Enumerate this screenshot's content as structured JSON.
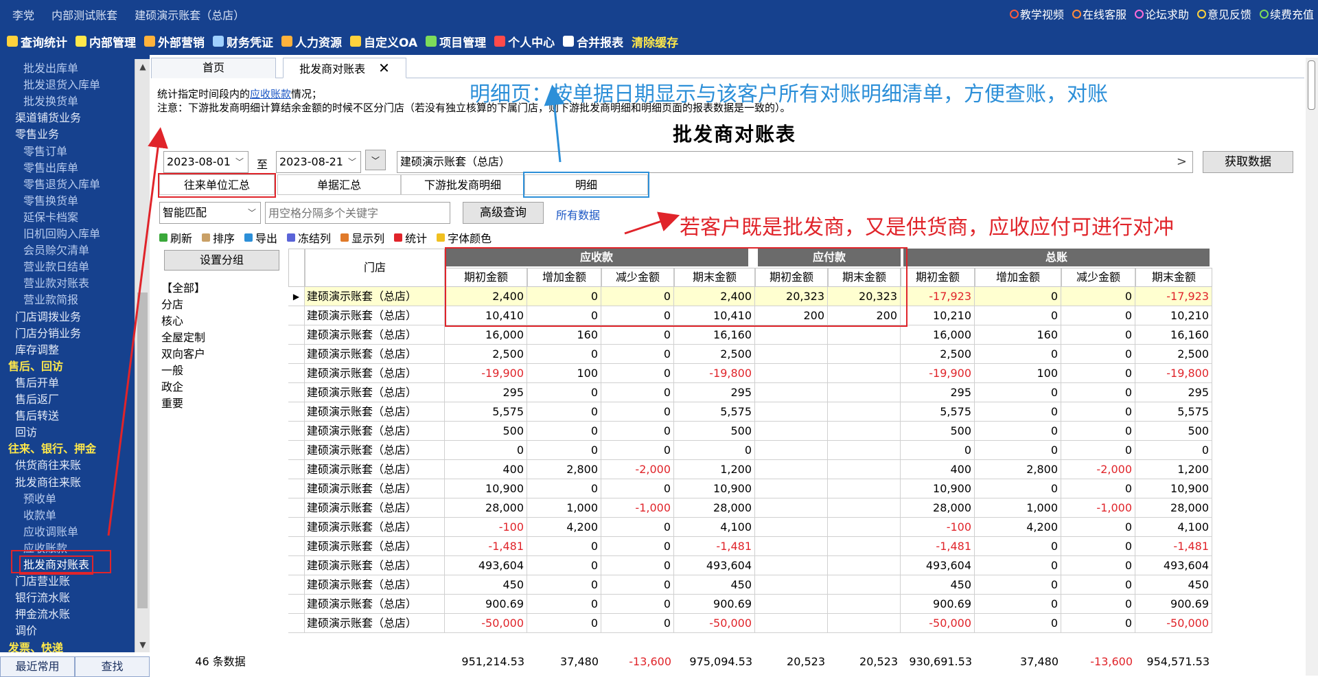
{
  "header": {
    "user": "李党",
    "account": "内部测试账套",
    "company": "建硕演示账套（总店）",
    "links": [
      {
        "label": "教学视频",
        "icon": "play-icon",
        "color": "#ff5a3c"
      },
      {
        "label": "在线客服",
        "icon": "service-icon",
        "color": "#ff8c3c"
      },
      {
        "label": "论坛求助",
        "icon": "forum-icon",
        "color": "#ff6cd8"
      },
      {
        "label": "意见反馈",
        "icon": "pen-icon",
        "color": "#ffd23c"
      },
      {
        "label": "续费充值",
        "icon": "coin-icon",
        "color": "#7ddc5a"
      }
    ]
  },
  "menu": [
    {
      "label": "查询统计",
      "icon": "chart-icon",
      "color": "#ffd23c"
    },
    {
      "label": "内部管理",
      "icon": "diamond-icon",
      "color": "#ffe84a"
    },
    {
      "label": "外部营销",
      "icon": "bag-icon",
      "color": "#ffb23c"
    },
    {
      "label": "财务凭证",
      "icon": "document-icon",
      "color": "#9fd0ff"
    },
    {
      "label": "人力资源",
      "icon": "person-icon",
      "color": "#ffb23c"
    },
    {
      "label": "自定义OA",
      "icon": "tools-icon",
      "color": "#ffd23c"
    },
    {
      "label": "项目管理",
      "icon": "gear-icon",
      "color": "#7ddc5a"
    },
    {
      "label": "个人中心",
      "icon": "heart-icon",
      "color": "#ff4a4a"
    },
    {
      "label": "合并报表",
      "icon": "file-icon",
      "color": "#ffffff"
    },
    {
      "label": "清除缓存",
      "icon": "",
      "color": "",
      "yellow": true
    }
  ],
  "sidebar": {
    "items": [
      {
        "label": "批发出库单",
        "level": 3
      },
      {
        "label": "批发退货入库单",
        "level": 3
      },
      {
        "label": "批发换货单",
        "level": 3
      },
      {
        "label": "渠道铺货业务",
        "level": 2
      },
      {
        "label": "零售业务",
        "level": 2
      },
      {
        "label": "零售订单",
        "level": 3
      },
      {
        "label": "零售出库单",
        "level": 3
      },
      {
        "label": "零售退货入库单",
        "level": 3
      },
      {
        "label": "零售换货单",
        "level": 3
      },
      {
        "label": "延保卡档案",
        "level": 3
      },
      {
        "label": "旧机回购入库单",
        "level": 3
      },
      {
        "label": "会员赊欠清单",
        "level": 3
      },
      {
        "label": "营业款日结单",
        "level": 3
      },
      {
        "label": "营业款对账表",
        "level": 3
      },
      {
        "label": "营业款简报",
        "level": 3
      },
      {
        "label": "门店调拨业务",
        "level": 2
      },
      {
        "label": "门店分销业务",
        "level": 2
      },
      {
        "label": "库存调整",
        "level": 2
      },
      {
        "label": "售后、回访",
        "level": 1
      },
      {
        "label": "售后开单",
        "level": 2
      },
      {
        "label": "售后返厂",
        "level": 2
      },
      {
        "label": "售后转送",
        "level": 2
      },
      {
        "label": "回访",
        "level": 2
      },
      {
        "label": "往来、银行、押金",
        "level": 1
      },
      {
        "label": "供货商往来账",
        "level": 2
      },
      {
        "label": "批发商往来账",
        "level": 2
      },
      {
        "label": "预收单",
        "level": 3
      },
      {
        "label": "收款单",
        "level": 3
      },
      {
        "label": "应收调账单",
        "level": 3
      },
      {
        "label": "应收账款",
        "level": 3
      },
      {
        "label": "批发商对账表",
        "level": 3,
        "selected": true
      },
      {
        "label": "门店营业账",
        "level": 2
      },
      {
        "label": "银行流水账",
        "level": 2
      },
      {
        "label": "押金流水账",
        "level": 2
      },
      {
        "label": "调价",
        "level": 2
      },
      {
        "label": "发票、快递",
        "level": 1
      }
    ],
    "bottom_tabs": [
      "最近常用",
      "查找"
    ]
  },
  "tabs": [
    {
      "label": "首页"
    },
    {
      "label": "批发商对账表",
      "closable": true
    }
  ],
  "description": {
    "line1_prefix": "统计指定时间段内的",
    "line1_link": "应收账款",
    "line1_suffix": "情况；",
    "line2": "注意：下游批发商明细计算结余金额的时候不区分门店（若没有独立核算的下属门店，则下游批发商明细和明细页面的报表数据是一致的）。"
  },
  "annotations": {
    "detail_note": "明细页：按单据日期显示与该客户所有对账明细清单，方便查账，对账",
    "offset_note": "若客户既是批发商，又是供货商，应收应付可进行对冲"
  },
  "report_title": "批发商对账表",
  "filters": {
    "date_from": "2023-08-01",
    "date_to": "2023-08-21",
    "to_label": "至",
    "company": "建硕演示账套（总店）",
    "fetch_label": "获取数据",
    "match_mode": "智能匹配",
    "keyword_placeholder": "用空格分隔多个关键字",
    "advanced_label": "高级查询",
    "all_data_label": "所有数据"
  },
  "subtabs": [
    "往来单位汇总",
    "单据汇总",
    "下游批发商明细",
    "明细"
  ],
  "toolbar": [
    {
      "label": "刷新",
      "icon": "refresh-icon",
      "color": "#3aa83a"
    },
    {
      "label": "排序",
      "icon": "sort-icon",
      "color": "#c9a066"
    },
    {
      "label": "导出",
      "icon": "export-icon",
      "color": "#2c8fd8"
    },
    {
      "label": "冻结列",
      "icon": "freeze-icon",
      "color": "#5a64d8"
    },
    {
      "label": "显示列",
      "icon": "columns-icon",
      "color": "#e07a2a"
    },
    {
      "label": "统计",
      "icon": "stats-icon",
      "color": "#e0242a"
    },
    {
      "label": "字体颜色",
      "icon": "font-color-icon",
      "color": "#f0c020"
    }
  ],
  "groups": {
    "button": "设置分组",
    "items": [
      "【全部】",
      "分店",
      "核心",
      "全屋定制",
      "双向客户",
      "一般",
      "政企",
      "重要"
    ]
  },
  "table": {
    "group_headers": [
      "应收款",
      "应付款",
      "总账"
    ],
    "store_header": "门店",
    "columns": [
      "期初金额",
      "增加金额",
      "减少金额",
      "期末金额",
      "期初金额",
      "期末金额",
      "期初金额",
      "增加金额",
      "减少金额",
      "期末金额"
    ],
    "rows": [
      {
        "store": "建硕演示账套（总店）",
        "v": [
          "2,400",
          "0",
          "0",
          "2,400",
          "20,323",
          "20,323",
          "-17,923",
          "0",
          "0",
          "-17,923"
        ]
      },
      {
        "store": "建硕演示账套（总店）",
        "v": [
          "10,410",
          "0",
          "0",
          "10,410",
          "200",
          "200",
          "10,210",
          "0",
          "0",
          "10,210"
        ]
      },
      {
        "store": "建硕演示账套（总店）",
        "v": [
          "16,000",
          "160",
          "0",
          "16,160",
          "",
          "",
          "16,000",
          "160",
          "0",
          "16,160"
        ]
      },
      {
        "store": "建硕演示账套（总店）",
        "v": [
          "2,500",
          "0",
          "0",
          "2,500",
          "",
          "",
          "2,500",
          "0",
          "0",
          "2,500"
        ]
      },
      {
        "store": "建硕演示账套（总店）",
        "v": [
          "-19,900",
          "100",
          "0",
          "-19,800",
          "",
          "",
          "-19,900",
          "100",
          "0",
          "-19,800"
        ]
      },
      {
        "store": "建硕演示账套（总店）",
        "v": [
          "295",
          "0",
          "0",
          "295",
          "",
          "",
          "295",
          "0",
          "0",
          "295"
        ]
      },
      {
        "store": "建硕演示账套（总店）",
        "v": [
          "5,575",
          "0",
          "0",
          "5,575",
          "",
          "",
          "5,575",
          "0",
          "0",
          "5,575"
        ]
      },
      {
        "store": "建硕演示账套（总店）",
        "v": [
          "500",
          "0",
          "0",
          "500",
          "",
          "",
          "500",
          "0",
          "0",
          "500"
        ]
      },
      {
        "store": "建硕演示账套（总店）",
        "v": [
          "0",
          "0",
          "0",
          "0",
          "",
          "",
          "0",
          "0",
          "0",
          "0"
        ]
      },
      {
        "store": "建硕演示账套（总店）",
        "v": [
          "400",
          "2,800",
          "-2,000",
          "1,200",
          "",
          "",
          "400",
          "2,800",
          "-2,000",
          "1,200"
        ]
      },
      {
        "store": "建硕演示账套（总店）",
        "v": [
          "10,900",
          "0",
          "0",
          "10,900",
          "",
          "",
          "10,900",
          "0",
          "0",
          "10,900"
        ]
      },
      {
        "store": "建硕演示账套（总店）",
        "v": [
          "28,000",
          "1,000",
          "-1,000",
          "28,000",
          "",
          "",
          "28,000",
          "1,000",
          "-1,000",
          "28,000"
        ]
      },
      {
        "store": "建硕演示账套（总店）",
        "v": [
          "-100",
          "4,200",
          "0",
          "4,100",
          "",
          "",
          "-100",
          "4,200",
          "0",
          "4,100"
        ]
      },
      {
        "store": "建硕演示账套（总店）",
        "v": [
          "-1,481",
          "0",
          "0",
          "-1,481",
          "",
          "",
          "-1,481",
          "0",
          "0",
          "-1,481"
        ]
      },
      {
        "store": "建硕演示账套（总店）",
        "v": [
          "493,604",
          "0",
          "0",
          "493,604",
          "",
          "",
          "493,604",
          "0",
          "0",
          "493,604"
        ]
      },
      {
        "store": "建硕演示账套（总店）",
        "v": [
          "450",
          "0",
          "0",
          "450",
          "",
          "",
          "450",
          "0",
          "0",
          "450"
        ]
      },
      {
        "store": "建硕演示账套（总店）",
        "v": [
          "900.69",
          "0",
          "0",
          "900.69",
          "",
          "",
          "900.69",
          "0",
          "0",
          "900.69"
        ]
      },
      {
        "store": "建硕演示账套（总店）",
        "v": [
          "-50,000",
          "0",
          "0",
          "-50,000",
          "",
          "",
          "-50,000",
          "0",
          "0",
          "-50,000"
        ]
      }
    ],
    "count_label": "46 条数据",
    "totals": [
      "951,214.53",
      "37,480",
      "-13,600",
      "975,094.53",
      "20,523",
      "20,523",
      "930,691.53",
      "37,480",
      "-13,600",
      "954,571.53"
    ]
  },
  "colors": {
    "brand_blue": "#16418e",
    "annotation_red": "#e0242a",
    "annotation_blue": "#2c8fd8",
    "highlight": "#ffffd0"
  }
}
